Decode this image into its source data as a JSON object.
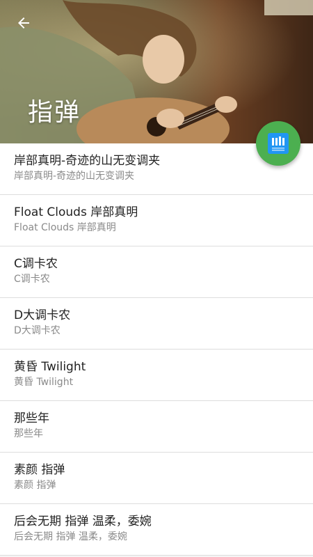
{
  "header": {
    "title": "指弹",
    "back_icon": "arrow-left-icon"
  },
  "fab": {
    "icon": "sheet-music-icon",
    "color": "#4caf50",
    "icon_color": "#2196f3"
  },
  "songs": [
    {
      "title": "岸部真明-奇迹的山无变调夹",
      "subtitle": "岸部真明-奇迹的山无变调夹"
    },
    {
      "title": "Float Clouds 岸部真明",
      "subtitle": "Float Clouds 岸部真明"
    },
    {
      "title": "C调卡农",
      "subtitle": "C调卡农"
    },
    {
      "title": "D大调卡农",
      "subtitle": "D大调卡农"
    },
    {
      "title": "黄昏 Twilight",
      "subtitle": "黄昏 Twilight"
    },
    {
      "title": "那些年",
      "subtitle": "那些年"
    },
    {
      "title": "素颜 指弹",
      "subtitle": "素颜 指弹"
    },
    {
      "title": "后会无期 指弹 温柔，委婉",
      "subtitle": "后会无期 指弹 温柔，委婉"
    }
  ]
}
